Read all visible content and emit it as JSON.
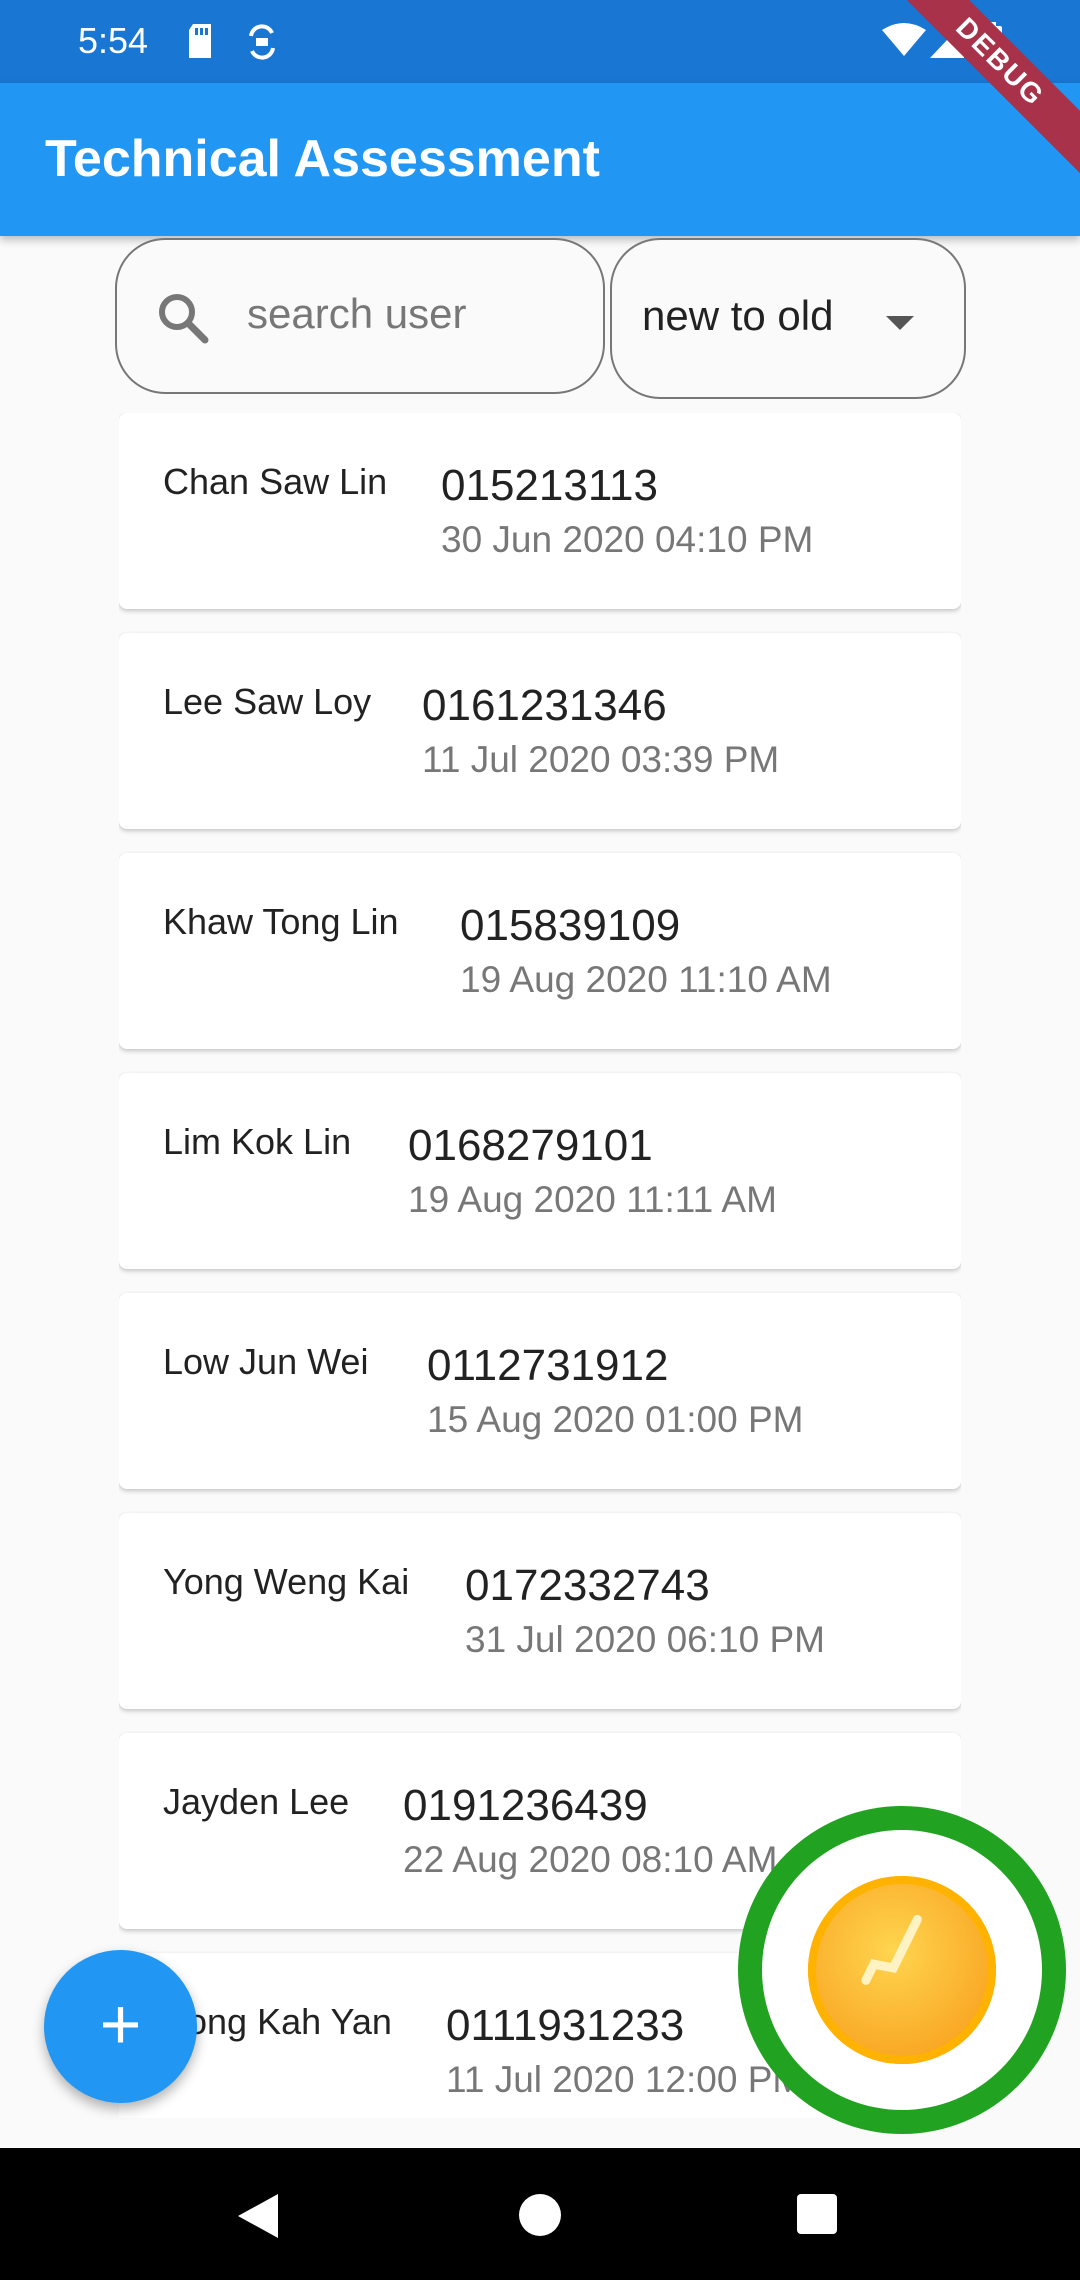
{
  "status_bar": {
    "time": "5:54",
    "icons": [
      "sd-card-icon",
      "sync-icon",
      "wifi-icon",
      "signal-icon",
      "battery-icon"
    ]
  },
  "app_bar": {
    "title": "Technical Assessment",
    "debug_banner": "DEBUG"
  },
  "search": {
    "placeholder": "search user",
    "icon": "search-icon"
  },
  "sort": {
    "value": "new to old",
    "icon": "dropdown-arrow-icon"
  },
  "users": [
    {
      "name": "Chan Saw Lin",
      "phone": "015213113",
      "date": "30 Jun 2020 04:10 PM"
    },
    {
      "name": "Lee Saw Loy",
      "phone": "0161231346",
      "date": "11 Jul 2020 03:39 PM"
    },
    {
      "name": "Khaw Tong Lin",
      "phone": "015839109",
      "date": "19 Aug 2020 11:10 AM"
    },
    {
      "name": "Lim Kok Lin",
      "phone": "0168279101",
      "date": "19 Aug 2020 11:11 AM"
    },
    {
      "name": "Low Jun Wei",
      "phone": "0112731912",
      "date": "15 Aug 2020 01:00 PM"
    },
    {
      "name": "Yong Weng Kai",
      "phone": "0172332743",
      "date": "31 Jul 2020 06:10 PM"
    },
    {
      "name": "Jayden Lee",
      "phone": "0191236439",
      "date": "22 Aug 2020 08:10 AM"
    },
    {
      "name": "Kong Kah Yan",
      "phone": "0111931233",
      "date": "11 Jul 2020 12:00 PM"
    }
  ],
  "fab": {
    "label": "+",
    "icon": "add-icon"
  },
  "overlay": {
    "icon": "coin-reward-icon"
  },
  "nav_bar": {
    "icons": [
      "back-icon",
      "home-icon",
      "recents-icon"
    ]
  },
  "colors": {
    "status_bar": "#1976d2",
    "app_bar": "#2196f3",
    "fab": "#2196f3",
    "coin_ring": "#21a321",
    "coin_gold": "#f9a825"
  }
}
